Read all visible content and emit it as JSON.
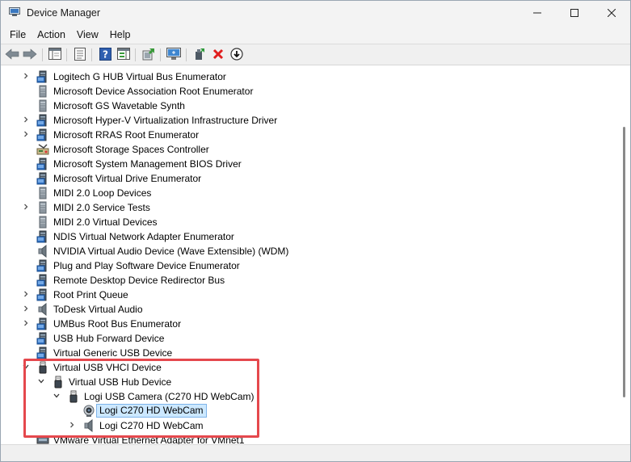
{
  "window": {
    "title": "Device Manager",
    "app_icon": "device-manager-icon",
    "controls": [
      "minimize-icon",
      "maximize-icon",
      "close-icon"
    ]
  },
  "menu": {
    "items": [
      "File",
      "Action",
      "View",
      "Help"
    ]
  },
  "toolbar": {
    "buttons": [
      "back-icon",
      "forward-icon",
      "show-hide-console-tree-icon",
      "properties-icon",
      "help-icon",
      "action-pane-icon",
      "update-driver-icon",
      "scan-hardware-icon",
      "enable-device-icon",
      "uninstall-device-icon",
      "disable-device-icon"
    ]
  },
  "tree": {
    "rows": [
      {
        "label": "Logitech G HUB Virtual Bus Enumerator",
        "expander": "collapsed",
        "icon": "system-device"
      },
      {
        "label": "Microsoft Device Association Root Enumerator",
        "expander": "none",
        "icon": "generic-device"
      },
      {
        "label": "Microsoft GS Wavetable Synth",
        "expander": "none",
        "icon": "generic-device"
      },
      {
        "label": "Microsoft Hyper-V Virtualization Infrastructure Driver",
        "expander": "collapsed",
        "icon": "system-device"
      },
      {
        "label": "Microsoft RRAS Root Enumerator",
        "expander": "collapsed",
        "icon": "system-device"
      },
      {
        "label": "Microsoft Storage Spaces Controller",
        "expander": "none",
        "icon": "storage-controller"
      },
      {
        "label": "Microsoft System Management BIOS Driver",
        "expander": "none",
        "icon": "system-device"
      },
      {
        "label": "Microsoft Virtual Drive Enumerator",
        "expander": "none",
        "icon": "system-device"
      },
      {
        "label": "MIDI 2.0 Loop Devices",
        "expander": "none",
        "icon": "generic-device"
      },
      {
        "label": "MIDI 2.0 Service Tests",
        "expander": "collapsed",
        "icon": "generic-device"
      },
      {
        "label": "MIDI 2.0 Virtual Devices",
        "expander": "none",
        "icon": "generic-device"
      },
      {
        "label": "NDIS Virtual Network Adapter Enumerator",
        "expander": "none",
        "icon": "system-device"
      },
      {
        "label": "NVIDIA Virtual Audio Device (Wave Extensible) (WDM)",
        "expander": "none",
        "icon": "speaker-device"
      },
      {
        "label": "Plug and Play Software Device Enumerator",
        "expander": "none",
        "icon": "system-device"
      },
      {
        "label": "Remote Desktop Device Redirector Bus",
        "expander": "none",
        "icon": "system-device"
      },
      {
        "label": "Root Print Queue",
        "expander": "collapsed",
        "icon": "system-device"
      },
      {
        "label": "ToDesk Virtual Audio",
        "expander": "collapsed",
        "icon": "speaker-device"
      },
      {
        "label": "UMBus Root Bus Enumerator",
        "expander": "collapsed",
        "icon": "system-device"
      },
      {
        "label": "USB Hub Forward Device",
        "expander": "none",
        "icon": "system-device"
      },
      {
        "label": "Virtual Generic USB Device",
        "expander": "none",
        "icon": "system-device"
      },
      {
        "label": "Virtual USB VHCI Device",
        "expander": "expanded",
        "icon": "usb-device"
      },
      {
        "label": "Virtual USB Hub Device",
        "expander": "expanded",
        "icon": "usb-device"
      },
      {
        "label": "Logi USB Camera (C270 HD WebCam)",
        "expander": "expanded",
        "icon": "usb-device"
      },
      {
        "label": "Logi C270 HD WebCam",
        "expander": "none",
        "icon": "webcam-device",
        "selected": true
      },
      {
        "label": "Logi C270 HD WebCam",
        "expander": "collapsed",
        "icon": "speaker-device"
      },
      {
        "label": "VMware Virtual Ethernet Adapter for VMnet1",
        "expander": "none",
        "icon": "network-device"
      }
    ]
  },
  "highlight": {
    "color": "#e5484d"
  }
}
